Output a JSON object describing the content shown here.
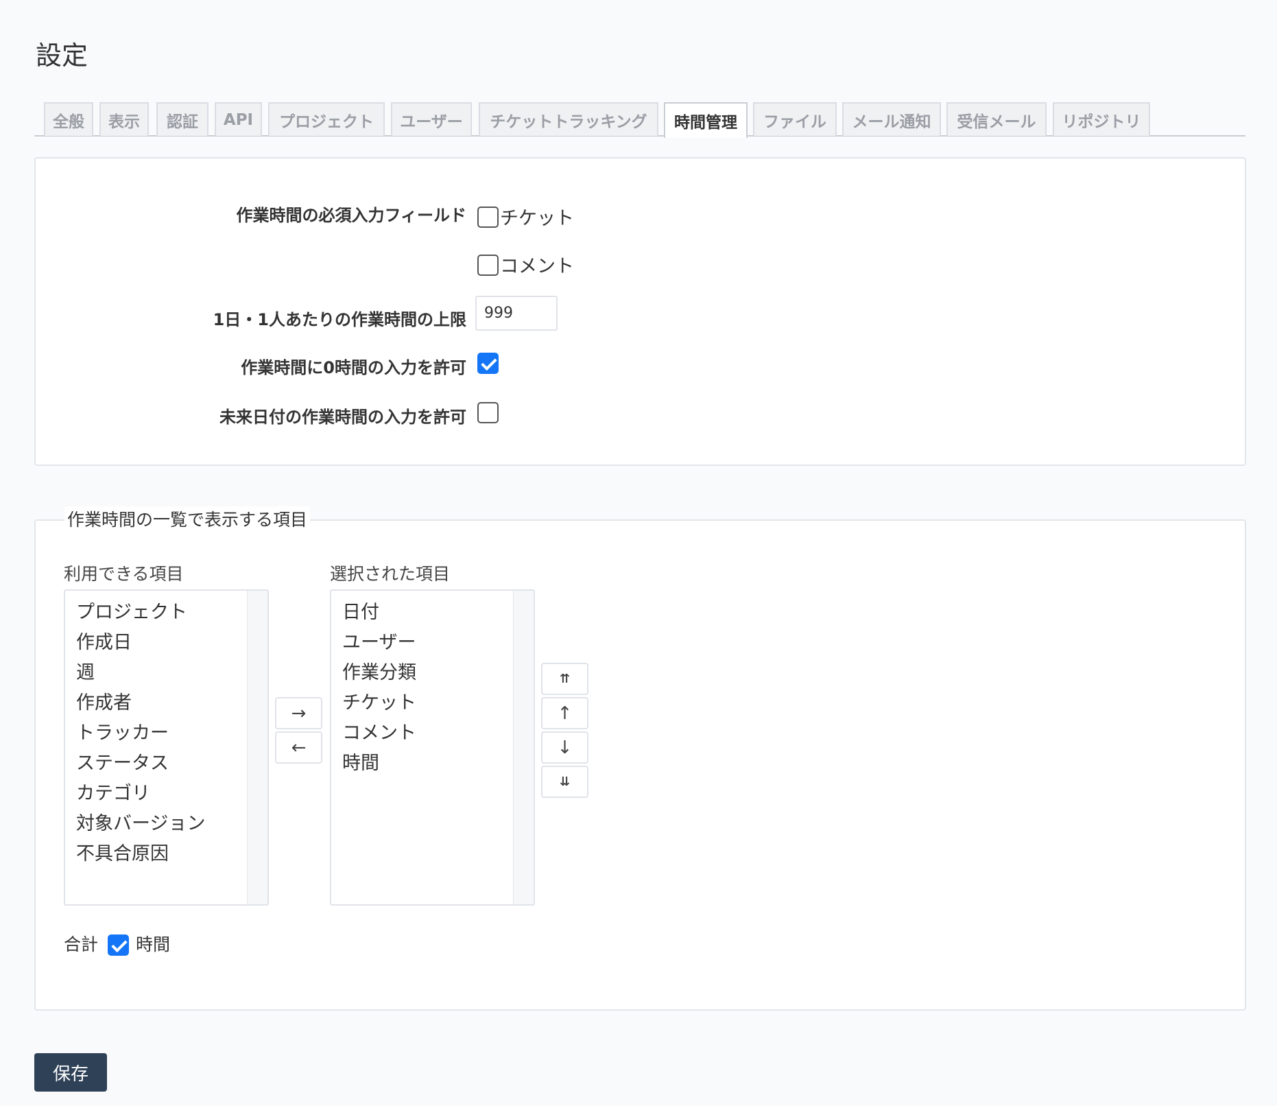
{
  "page": {
    "title": "設定"
  },
  "tabs": [
    {
      "label": "全般",
      "active": false
    },
    {
      "label": "表示",
      "active": false
    },
    {
      "label": "認証",
      "active": false
    },
    {
      "label": "API",
      "active": false
    },
    {
      "label": "プロジェクト",
      "active": false
    },
    {
      "label": "ユーザー",
      "active": false
    },
    {
      "label": "チケットトラッキング",
      "active": false
    },
    {
      "label": "時間管理",
      "active": true
    },
    {
      "label": "ファイル",
      "active": false
    },
    {
      "label": "メール通知",
      "active": false
    },
    {
      "label": "受信メール",
      "active": false
    },
    {
      "label": "リポジトリ",
      "active": false
    }
  ],
  "settings": {
    "required_fields": {
      "label": "作業時間の必須入力フィールド",
      "options": [
        {
          "label": "チケット",
          "checked": false
        },
        {
          "label": "コメント",
          "checked": false
        }
      ]
    },
    "max_hours": {
      "label": "1日・1人あたりの作業時間の上限",
      "value": "999"
    },
    "allow_zero": {
      "label": "作業時間に0時間の入力を許可",
      "checked": true
    },
    "allow_future": {
      "label": "未来日付の作業時間の入力を許可",
      "checked": false
    }
  },
  "columns": {
    "legend": "作業時間の一覧で表示する項目",
    "available_title": "利用できる項目",
    "available": [
      "プロジェクト",
      "作成日",
      "週",
      "作成者",
      "トラッカー",
      "ステータス",
      "カテゴリ",
      "対象バージョン",
      "不具合原因"
    ],
    "selected_title": "選択された項目",
    "selected": [
      "日付",
      "ユーザー",
      "作業分類",
      "チケット",
      "コメント",
      "時間"
    ],
    "move_right": "→",
    "move_left": "←",
    "move_top": "⇈",
    "move_up": "↑",
    "move_down": "↓",
    "move_bottom": "⇊"
  },
  "totals": {
    "label": "合計",
    "option": "時間",
    "checked": true
  },
  "save_label": "保存"
}
